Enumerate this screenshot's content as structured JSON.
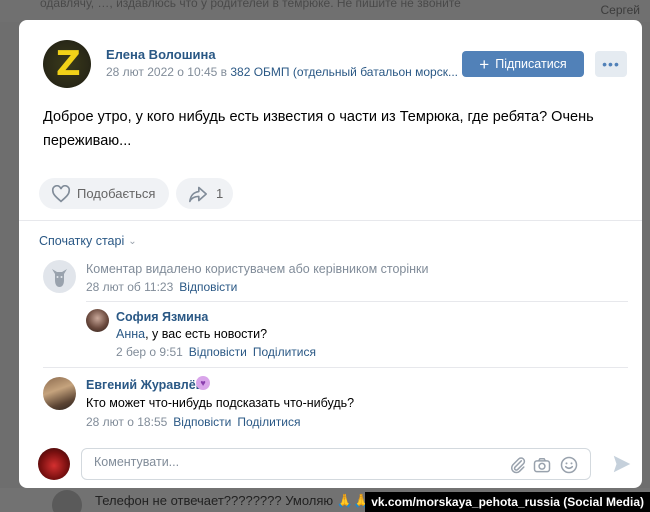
{
  "background": {
    "top_text": "одавлячу, …, издавлюсь что у родителей в темрюке. Не пишите не звоните",
    "top_name": "Сергей",
    "bottom_text": "Телефон не отвечает???????? Умоляю 🙏🙏😢😢 дайте знать"
  },
  "credit": "vk.com/morskaya_pehota_russia (Social Media)",
  "post": {
    "author": "Елена Волошина",
    "date": "28 лют 2022 о 10:45 в ",
    "group": "382 ОБМП (отдельный батальон морск...",
    "subscribe_label": "Підписатися",
    "more_label": "•••",
    "text": "Доброе утро, у кого нибудь есть известия о части из Темрюка, где ребята? Очень переживаю...",
    "like_label": "Подобається",
    "share_count": "1"
  },
  "comments": {
    "sort_label": "Спочатку старі",
    "deleted": {
      "text": "Коментар видалено користувачем або керівником сторінки",
      "date": "28 лют об 11:23",
      "reply_label": "Відповісти"
    },
    "reply": {
      "author": "София Язмина",
      "mention": "Анна",
      "text": ", у вас есть новости?",
      "date": "2 бер о 9:51",
      "reply_label": "Відповісти",
      "share_label": "Поділитися"
    },
    "evgeniy": {
      "author": "Евгений Журавлёв",
      "text": "Кто может что-нибудь подсказать что-нибудь?",
      "date": "28 лют о 18:55",
      "reply_label": "Відповісти",
      "share_label": "Поділитися"
    },
    "input_placeholder": "Коментувати..."
  },
  "colors": {
    "link": "#2a5885",
    "button": "#5181b8",
    "meta": "#818c99"
  }
}
